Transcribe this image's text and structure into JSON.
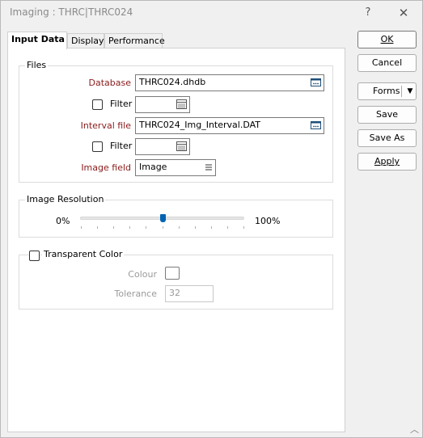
{
  "window": {
    "title": "Imaging : THRC|THRC024",
    "help": "?",
    "close": "✕"
  },
  "tabs": [
    {
      "label": "Input Data",
      "active": true
    },
    {
      "label": "Display",
      "active": false
    },
    {
      "label": "Performance",
      "active": false
    }
  ],
  "files": {
    "group_label": "Files",
    "database_label": "Database",
    "database_value": "THRC024.dhdb",
    "filter1_label": "Filter",
    "filter1_value": "",
    "interval_label": "Interval file",
    "interval_value": "THRC024_Img_Interval.DAT",
    "filter2_label": "Filter",
    "filter2_value": "",
    "image_field_label": "Image field",
    "image_field_value": "Image"
  },
  "resolution": {
    "group_label": "Image Resolution",
    "min_label": "0%",
    "max_label": "100%",
    "value_percent": 50
  },
  "transparent": {
    "label": "Transparent Color",
    "checked": false,
    "colour_label": "Colour",
    "tolerance_label": "Tolerance",
    "tolerance_value": "32"
  },
  "buttons": {
    "ok": "OK",
    "cancel": "Cancel",
    "forms": "Forms",
    "save": "Save",
    "save_as": "Save As",
    "apply": "Apply"
  },
  "colors": {
    "required_label": "#8b1a1a",
    "slider_thumb": "#0063b1",
    "disabled_text": "#9a9a9a"
  }
}
